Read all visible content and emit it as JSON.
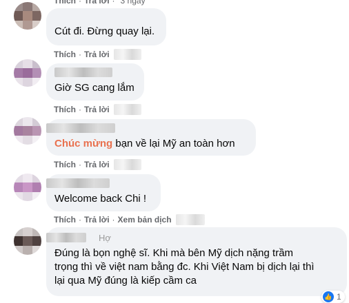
{
  "actions": {
    "like": "Thích",
    "reply": "Trả lời",
    "translate": "Xem bản dịch",
    "separator": "·"
  },
  "top_timestamp": "3 ngày",
  "comments": [
    {
      "text": "Cút đi. Đừng quay lại."
    },
    {
      "text": "Giờ SG cang lắm"
    },
    {
      "mention": "Chúc mừng",
      "text": " bạn về lại Mỹ an toàn hơn"
    },
    {
      "text": "Welcome back Chi !"
    },
    {
      "mention": "Hợ",
      "lines": [
        "Đúng là bọn nghệ sĩ. Khi mà bên Mỹ dịch nặng trầm",
        "trọng thì về việt nam bằng đc. Khi Việt Nam bị dịch lại thì",
        "lại qua Mỹ đúng là kiếp cầm ca"
      ],
      "reaction_count": "1"
    }
  ],
  "colors": {
    "bubble": "#f0f2f5",
    "meta": "#65676b",
    "mention": "#e9714f",
    "like": "#1877f2"
  },
  "icons": {
    "reaction": "like-icon"
  }
}
